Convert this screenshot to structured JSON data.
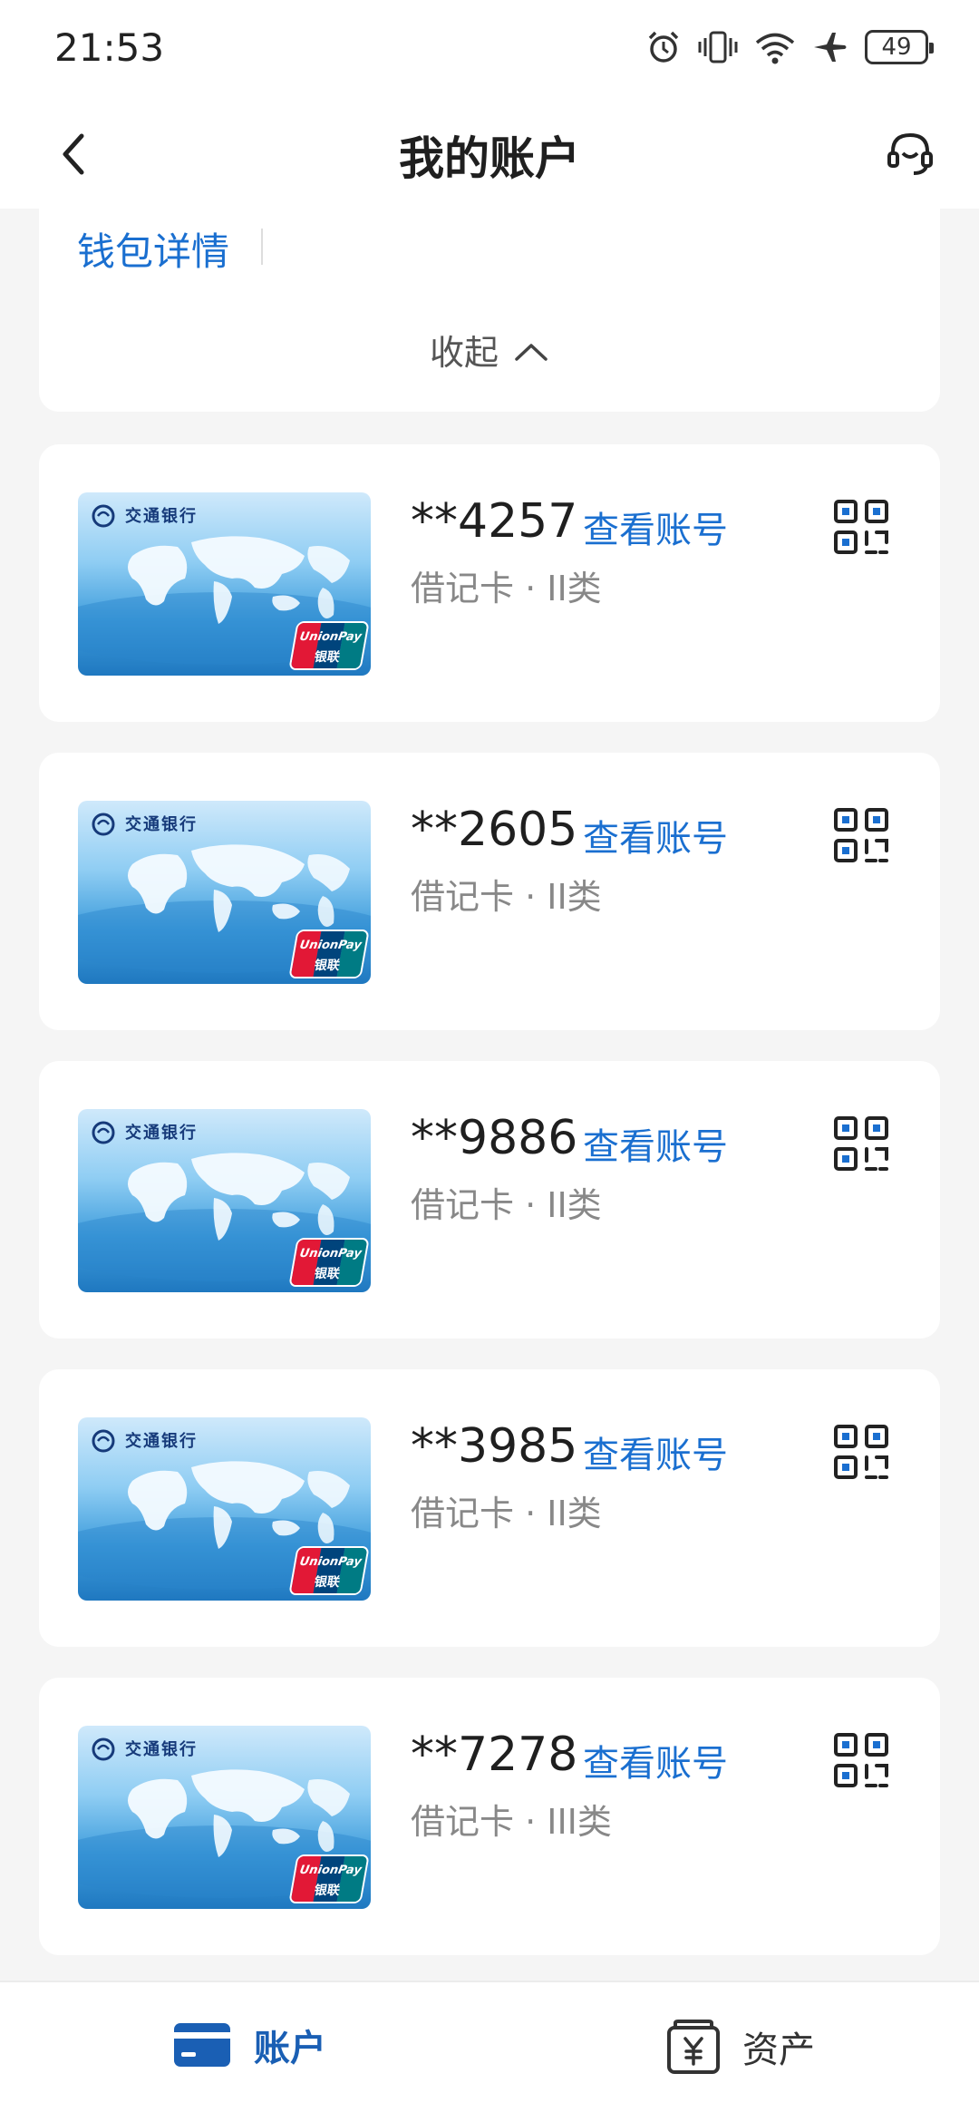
{
  "status_bar": {
    "time": "21:53",
    "battery": "49",
    "icons": [
      "alarm-icon",
      "vibrate-icon",
      "wifi-icon",
      "airplane-icon",
      "battery-icon"
    ]
  },
  "header": {
    "title": "我的账户",
    "back_icon": "chevron-left-icon",
    "service_icon": "headset-icon"
  },
  "wallet": {
    "link_label": "钱包详情",
    "collapse_label": "收起",
    "collapse_icon": "chevron-up-icon"
  },
  "accounts": [
    {
      "number": "**4257",
      "view_label": "查看账号",
      "type": "借记卡 · II类"
    },
    {
      "number": "**2605",
      "view_label": "查看账号",
      "type": "借记卡 · II类"
    },
    {
      "number": "**9886",
      "view_label": "查看账号",
      "type": "借记卡 · II类"
    },
    {
      "number": "**3985",
      "view_label": "查看账号",
      "type": "借记卡 · II类"
    },
    {
      "number": "**7278",
      "view_label": "查看账号",
      "type": "借记卡 · III类"
    }
  ],
  "card_art": {
    "bank_name": "交通银行",
    "unionpay_text": "UnionPay",
    "unionpay_cn": "银联"
  },
  "tabs": [
    {
      "label": "账户",
      "icon": "card-icon",
      "active": true
    },
    {
      "label": "资产",
      "icon": "yen-wallet-icon",
      "active": false
    }
  ],
  "colors": {
    "accent": "#1a6fd0",
    "active_tab": "#1a5fb4",
    "background": "#f5f5f5"
  }
}
